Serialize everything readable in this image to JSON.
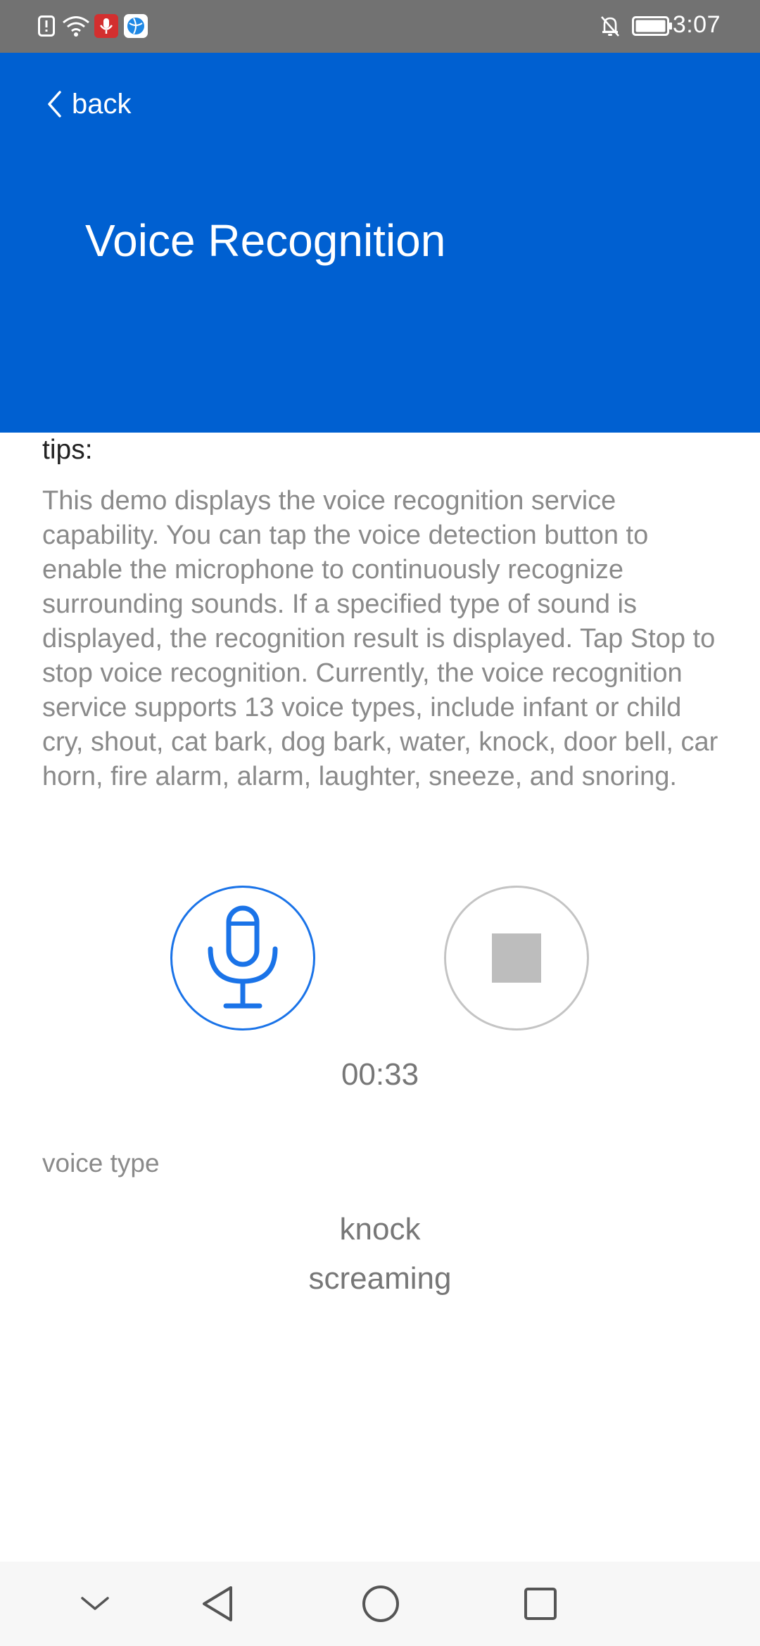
{
  "status_bar": {
    "time": "3:07",
    "icons": [
      "alert-icon",
      "wifi-icon",
      "mic-active-icon",
      "browser-app-icon",
      "silent-bell-icon",
      "battery-icon"
    ]
  },
  "header": {
    "back_label": "back",
    "title": "Voice Recognition",
    "background_color": "#0060d1"
  },
  "tips": {
    "label": "tips:",
    "text": "This demo displays the voice recognition service capability. You can tap the voice detection button to enable the microphone to continuously recognize surrounding sounds. If a specified type of sound is displayed, the recognition result is displayed. Tap Stop to stop voice recognition. Currently, the voice recognition service supports 13 voice types, include infant or child cry, shout, cat bark, dog bark, water, knock, door bell, car horn, fire alarm, alarm, laughter, sneeze, and snoring."
  },
  "controls": {
    "mic_icon": "microphone-icon",
    "stop_icon": "stop-icon",
    "accent_color": "#1a73e8"
  },
  "timer": "00:33",
  "voice_type": {
    "label": "voice type",
    "results": [
      "knock",
      "screaming"
    ]
  },
  "nav_bar": {
    "icons": [
      "chevron-down-icon",
      "back-triangle-icon",
      "home-circle-icon",
      "recents-square-icon"
    ]
  }
}
